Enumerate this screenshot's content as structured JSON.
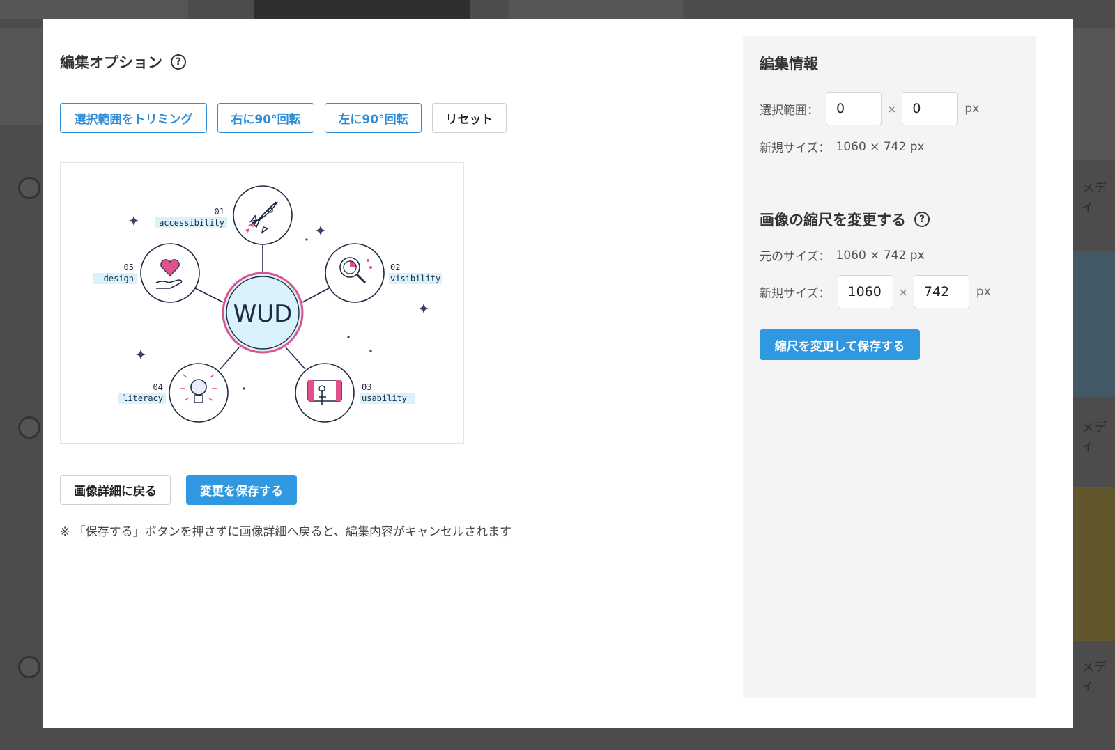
{
  "background": {
    "right_labels": [
      "メディ",
      "メディ",
      "メディ"
    ]
  },
  "edit_options": {
    "title": "編集オプション",
    "help_glyph": "?",
    "buttons": {
      "trim": "選択範囲をトリミング",
      "rotate_right": "右に90°回転",
      "rotate_left": "左に90°回転",
      "reset": "リセット"
    }
  },
  "preview": {
    "center_label": "WUD",
    "nodes": [
      {
        "number": "01",
        "label": "accessibility",
        "icon": "rocket-icon"
      },
      {
        "number": "02",
        "label": "visibility",
        "icon": "magnifier-chart-icon"
      },
      {
        "number": "03",
        "label": "usability",
        "icon": "touch-screen-icon"
      },
      {
        "number": "04",
        "label": "literacy",
        "icon": "lightbulb-icon"
      },
      {
        "number": "05",
        "label": "design",
        "icon": "heart-hand-icon"
      }
    ],
    "colors": {
      "pink": "#e0528c",
      "light_blue": "#d9f2fb",
      "navy": "#1f2a44"
    }
  },
  "actions": {
    "back": "画像詳細に戻る",
    "save": "変更を保存する",
    "note": "※ 「保存する」ボタンを押さずに画像詳細へ戻ると、編集内容がキャンセルされます"
  },
  "edit_info": {
    "title": "編集情報",
    "selection_label": "選択範囲：",
    "selection_width": "0",
    "selection_height": "0",
    "times": "×",
    "unit": "px",
    "new_size_label": "新規サイズ：",
    "new_size_value": "1060 × 742 px"
  },
  "scale": {
    "title": "画像の縮尺を変更する",
    "help_glyph": "?",
    "original_label": "元のサイズ：",
    "original_value": "1060 × 742 px",
    "new_size_label": "新規サイズ：",
    "width": "1060",
    "height": "742",
    "times": "×",
    "unit": "px",
    "save_button": "縮尺を変更して保存する"
  },
  "colors": {
    "primary": "#2f98e0",
    "panel_bg": "#f4f4f4"
  }
}
